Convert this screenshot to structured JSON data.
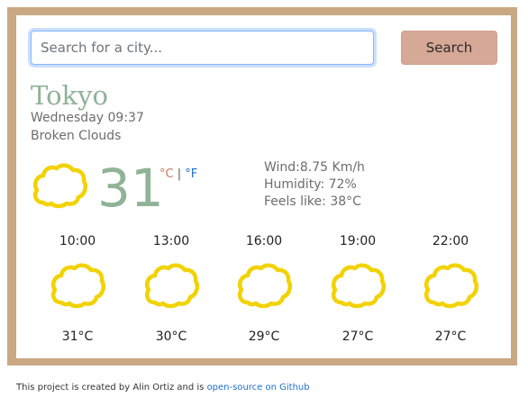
{
  "search": {
    "placeholder": "Search for a city...",
    "button_label": "Search"
  },
  "current": {
    "city": "Tokyo",
    "date": "Wednesday 09:37",
    "description": "Broken Clouds",
    "icon": "cloud-icon",
    "temperature": "31",
    "unit_c": "°C",
    "unit_sep": "|",
    "unit_f": "°F",
    "wind": "Wind:8.75 Km/h",
    "humidity": "Humidity: 72%",
    "feels_like": "Feels like: 38°C"
  },
  "forecast": [
    {
      "time": "10:00",
      "icon": "cloud-icon",
      "temp": "31°C"
    },
    {
      "time": "13:00",
      "icon": "cloud-icon",
      "temp": "30°C"
    },
    {
      "time": "16:00",
      "icon": "cloud-icon",
      "temp": "29°C"
    },
    {
      "time": "19:00",
      "icon": "cloud-icon",
      "temp": "27°C"
    },
    {
      "time": "22:00",
      "icon": "cloud-icon",
      "temp": "27°C"
    }
  ],
  "footer": {
    "text": "This project is created by Alin Ortiz and is ",
    "link_label": "open-source on Github"
  },
  "colors": {
    "frame": "#c9a884",
    "accent_green": "#8fb396",
    "button": "#d6a896",
    "cloud": "#f2d200",
    "link": "#1f6fd0"
  }
}
